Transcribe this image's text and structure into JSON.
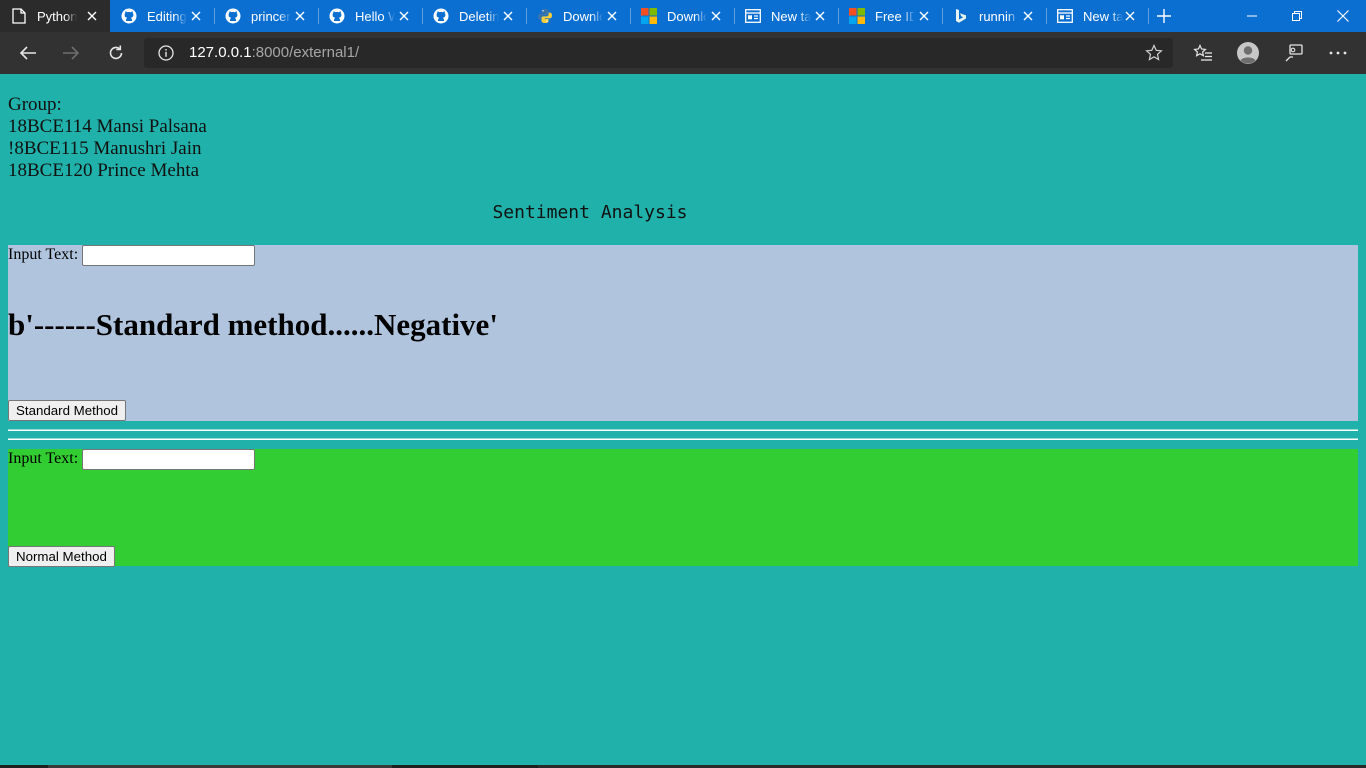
{
  "browser": {
    "tabs": [
      {
        "title": "Python",
        "icon": "page-icon"
      },
      {
        "title": "Editing",
        "icon": "github-icon"
      },
      {
        "title": "princer",
        "icon": "github-icon"
      },
      {
        "title": "Hello W",
        "icon": "github-icon"
      },
      {
        "title": "Deletin",
        "icon": "github-icon"
      },
      {
        "title": "Downlo",
        "icon": "python-icon"
      },
      {
        "title": "Downlo",
        "icon": "microsoft-icon"
      },
      {
        "title": "New ta",
        "icon": "newtab-icon"
      },
      {
        "title": "Free ID",
        "icon": "microsoft-icon"
      },
      {
        "title": "runnin",
        "icon": "bing-icon"
      },
      {
        "title": "New ta",
        "icon": "newtab-icon"
      }
    ],
    "address": {
      "host": "127.0.0.1",
      "rest": ":8000/external1/"
    }
  },
  "page": {
    "group_lines": [
      "Group:",
      "18BCE114 Mansi Palsana",
      "!8BCE115 Manushri Jain",
      "18BCE120 Prince Mehta"
    ],
    "title": "Sentiment Analysis",
    "standard": {
      "input_label": "Input Text:",
      "input_value": "",
      "result": "b'------Standard method......Negative'",
      "button_label": "Standard Method"
    },
    "normal": {
      "input_label": "Input Text:",
      "input_value": "",
      "button_label": "Normal Method"
    }
  },
  "colors": {
    "page_bg": "#20b2aa",
    "standard_panel": "#b0c4de",
    "normal_panel": "#32cd32",
    "tabstrip": "#0b6fd1",
    "active_tab": "#2b2b2b",
    "toolbar": "#323232"
  }
}
